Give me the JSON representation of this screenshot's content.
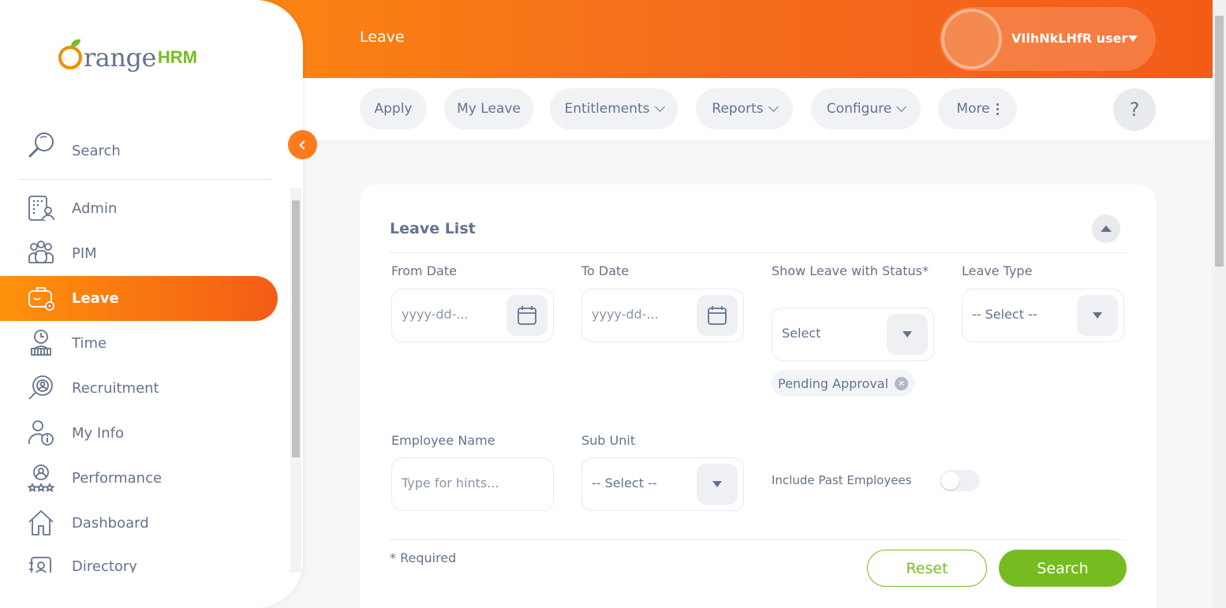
{
  "header": {
    "title": "Leave",
    "user_name": "VIlhNkLHfR user"
  },
  "topnav": {
    "items": [
      {
        "label": "Apply"
      },
      {
        "label": "My Leave"
      },
      {
        "label": "Entitlements"
      },
      {
        "label": "Reports"
      },
      {
        "label": "Configure"
      },
      {
        "label": "More"
      }
    ],
    "help_label": "?"
  },
  "sidebar": {
    "logo_text": "range",
    "logo_hrm": "HRM",
    "search_label": "Search",
    "items": [
      {
        "label": "Admin",
        "icon": "admin-icon"
      },
      {
        "label": "PIM",
        "icon": "pim-icon"
      },
      {
        "label": "Leave",
        "icon": "leave-icon",
        "active": true
      },
      {
        "label": "Time",
        "icon": "time-icon"
      },
      {
        "label": "Recruitment",
        "icon": "recruitment-icon"
      },
      {
        "label": "My Info",
        "icon": "my-info-icon"
      },
      {
        "label": "Performance",
        "icon": "performance-icon"
      },
      {
        "label": "Dashboard",
        "icon": "dashboard-icon"
      },
      {
        "label": "Directory",
        "icon": "directory-icon"
      }
    ]
  },
  "leave_list": {
    "title": "Leave List",
    "from_date": {
      "label": "From Date",
      "placeholder": "yyyy-dd-..."
    },
    "to_date": {
      "label": "To Date",
      "placeholder": "yyyy-dd-..."
    },
    "status": {
      "label": "Show Leave with Status*",
      "value": "Select",
      "chip": "Pending Approval"
    },
    "leave_type": {
      "label": "Leave Type",
      "value": "-- Select --"
    },
    "employee_name": {
      "label": "Employee Name",
      "placeholder": "Type for hints..."
    },
    "sub_unit": {
      "label": "Sub Unit",
      "value": "-- Select --"
    },
    "include_past": {
      "label": "Include Past Employees",
      "enabled": false
    },
    "required_note": "* Required",
    "reset_label": "Reset",
    "search_label": "Search"
  },
  "colors": {
    "brand_orange": "#f35c17",
    "brand_green": "#76bc21",
    "text": "#64728c"
  }
}
